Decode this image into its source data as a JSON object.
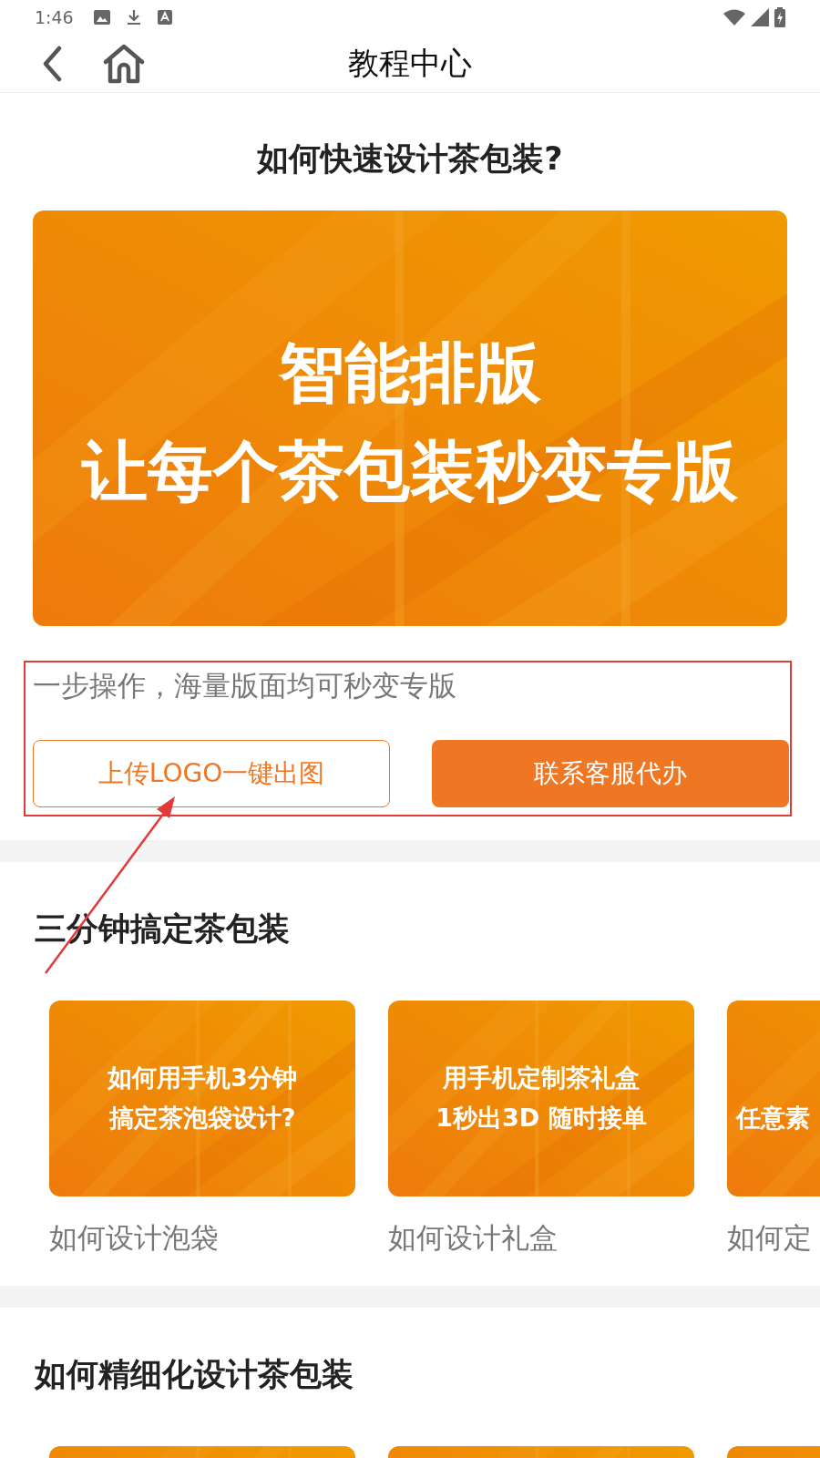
{
  "status_bar": {
    "time": "1:46"
  },
  "nav": {
    "title": "教程中心"
  },
  "hero": {
    "title": "如何快速设计茶包装?",
    "banner_lines": [
      "智能排版",
      "让每个茶包装秒变专版"
    ],
    "caption": "一步操作，海量版面均可秒变专版",
    "buttons": [
      {
        "label": "上传LOGO一键出图",
        "kind": "outline"
      },
      {
        "label": "联系客服代办",
        "kind": "filled"
      }
    ]
  },
  "sections": [
    {
      "heading": "三分钟搞定茶包装",
      "cards": [
        {
          "lines": [
            "如何用手机3分钟",
            "搞定茶泡袋设计?"
          ],
          "caption": "如何设计泡袋"
        },
        {
          "lines": [
            "用手机定制茶礼盒",
            "1秒出3D 随时接单"
          ],
          "caption": "如何设计礼盒"
        },
        {
          "lines": [
            "任意素"
          ],
          "caption": "如何定"
        }
      ]
    },
    {
      "heading": "如何精细化设计茶包装"
    }
  ]
}
